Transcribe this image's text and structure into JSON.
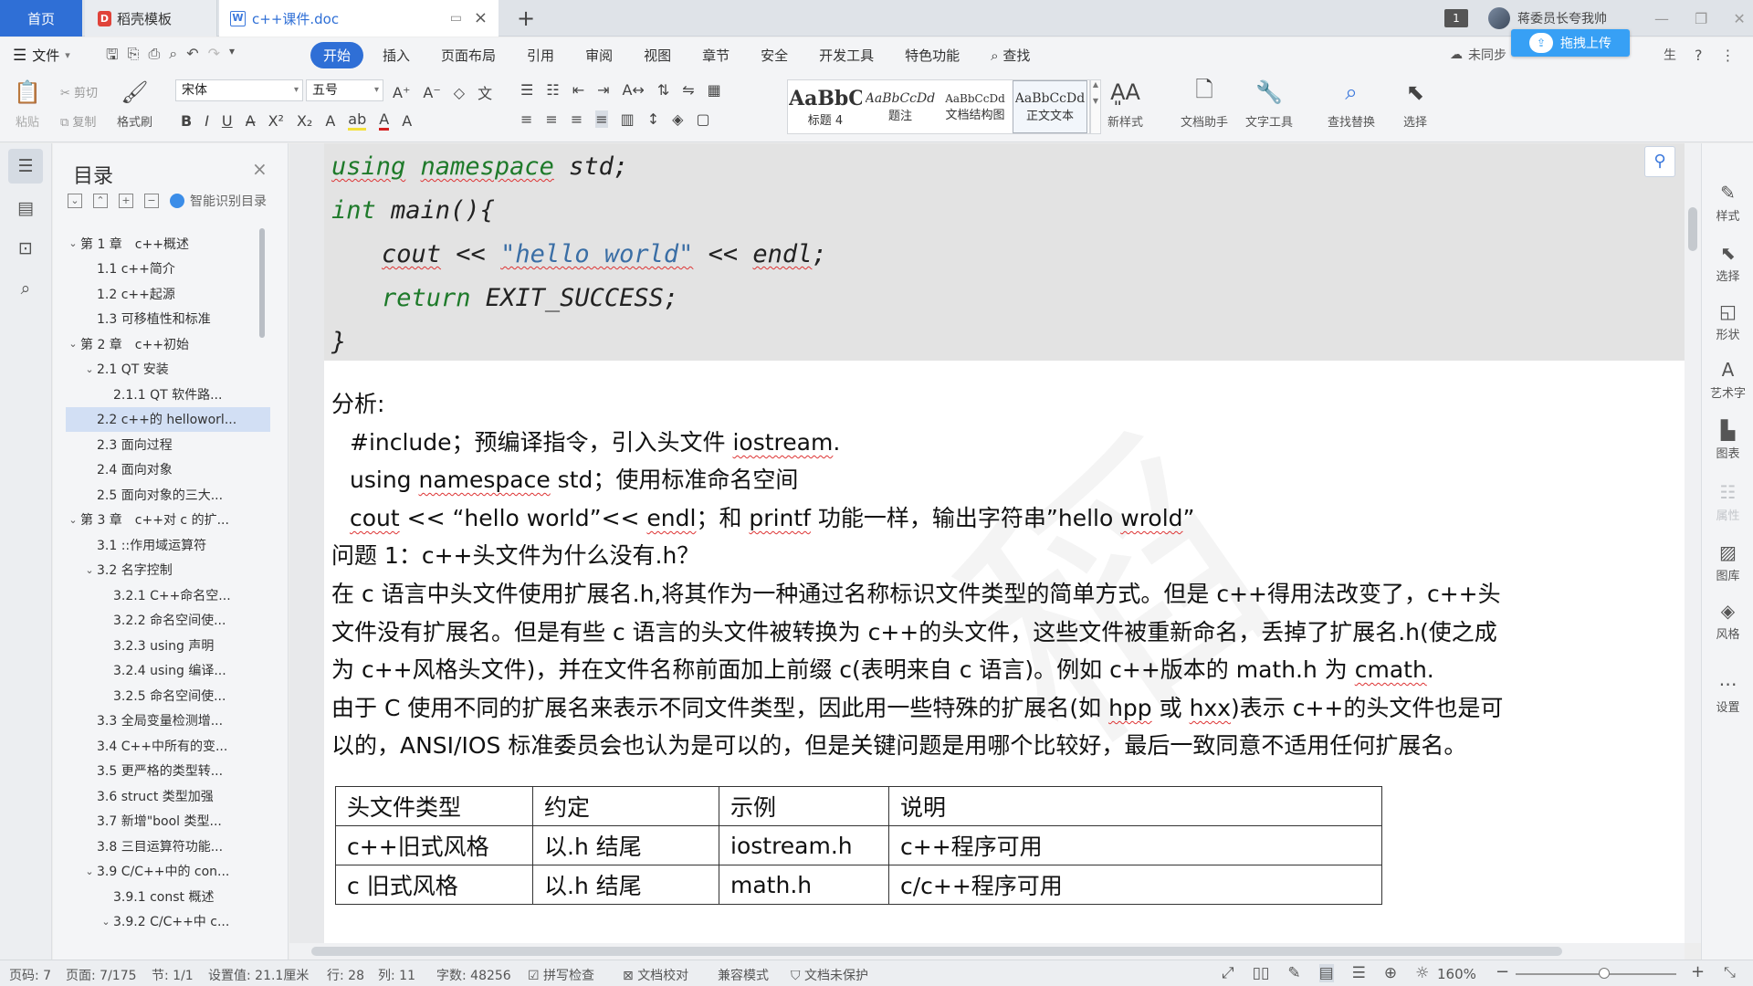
{
  "tabs": {
    "home": "首页",
    "daoke": "稻壳模板",
    "doc": "c++课件.doc",
    "badge": "1",
    "user": "蒋委员长夸我帅"
  },
  "menu": {
    "file": "文件",
    "items": [
      "开始",
      "插入",
      "页面布局",
      "引用",
      "审阅",
      "视图",
      "章节",
      "安全",
      "开发工具",
      "特色功能",
      "查找"
    ],
    "sync": "未同步",
    "upload": "拖拽上传",
    "share": "生"
  },
  "ribbon": {
    "paste": "粘贴",
    "cut": "剪切",
    "copy": "复制",
    "format_painter": "格式刷",
    "font_name": "宋体",
    "font_size": "五号",
    "styles": [
      {
        "sample": "AaBbCc",
        "name": "标题 4"
      },
      {
        "sample": "AaBbCcDd",
        "name": "题注"
      },
      {
        "sample": "AaBbCcDd",
        "name": "文档结构图"
      },
      {
        "sample": "AaBbCcDd",
        "name": "正文文本"
      }
    ],
    "new_style": "新样式",
    "doc_helper": "文档助手",
    "text_tools": "文字工具",
    "find_replace": "查找替换",
    "select": "选择"
  },
  "toc": {
    "title": "目录",
    "smart": "智能识别目录",
    "items": [
      {
        "label": "第 1 章　c++概述",
        "level": 1,
        "arrow": "v"
      },
      {
        "label": "1.1 c++简介",
        "level": 2,
        "arrow": ""
      },
      {
        "label": "1.2 c++起源",
        "level": 2,
        "arrow": ""
      },
      {
        "label": "1.3 可移植性和标准",
        "level": 2,
        "arrow": ""
      },
      {
        "label": "第 2 章　c++初始",
        "level": 1,
        "arrow": "v"
      },
      {
        "label": "2.1 QT 安装",
        "level": 2,
        "arrow": "v"
      },
      {
        "label": "2.1.1 QT 软件路...",
        "level": 3,
        "arrow": ""
      },
      {
        "label": "2.2 c++的 helloworl...",
        "level": 2,
        "arrow": "",
        "selected": true
      },
      {
        "label": "2.3 面向过程",
        "level": 2,
        "arrow": ""
      },
      {
        "label": "2.4 面向对象",
        "level": 2,
        "arrow": ""
      },
      {
        "label": "2.5 面向对象的三大...",
        "level": 2,
        "arrow": ""
      },
      {
        "label": "第 3 章　c++对 c 的扩...",
        "level": 1,
        "arrow": "v"
      },
      {
        "label": "3.1 ::作用域运算符",
        "level": 2,
        "arrow": ""
      },
      {
        "label": "3.2 名字控制",
        "level": 2,
        "arrow": "v"
      },
      {
        "label": "3.2.1 C++命名空...",
        "level": 3,
        "arrow": ""
      },
      {
        "label": "3.2.2 命名空间使...",
        "level": 3,
        "arrow": ""
      },
      {
        "label": "3.2.3 using 声明",
        "level": 3,
        "arrow": ""
      },
      {
        "label": "3.2.4 using 编译...",
        "level": 3,
        "arrow": ""
      },
      {
        "label": "3.2.5 命名空间使...",
        "level": 3,
        "arrow": ""
      },
      {
        "label": "3.3 全局变量检测增...",
        "level": 2,
        "arrow": ""
      },
      {
        "label": "3.4 C++中所有的变...",
        "level": 2,
        "arrow": ""
      },
      {
        "label": "3.5 更严格的类型转...",
        "level": 2,
        "arrow": ""
      },
      {
        "label": "3.6 struct 类型加强",
        "level": 2,
        "arrow": ""
      },
      {
        "label": "3.7 新增\"bool 类型...",
        "level": 2,
        "arrow": ""
      },
      {
        "label": "3.8 三目运算符功能...",
        "level": 2,
        "arrow": ""
      },
      {
        "label": "3.9 C/C++中的 con...",
        "level": 2,
        "arrow": "v"
      },
      {
        "label": "3.9.1 const 概述",
        "level": 3,
        "arrow": ""
      },
      {
        "label": "3.9.2 C/C++中 c...",
        "level": 3,
        "arrow": "v"
      }
    ]
  },
  "doc": {
    "code": {
      "line1_kw1": "using",
      "line1_kw2": "namespace",
      "line1_rest": " std;",
      "line2_kw": "int",
      "line2_rest": " main(){",
      "line3_a": "cout",
      "line3_b": " << ",
      "line3_str": "\"hello world\"",
      "line3_c": " << ",
      "line3_d": "endl",
      "line3_e": ";",
      "line4_kw": "return",
      "line4_rest": " EXIT_SUCCESS;",
      "line5": "}"
    },
    "analysis_heading": "分析:",
    "a1_pre": "#include；预编译指令，引入头文件 ",
    "a1_ul": "iostream",
    "a1_post": ".",
    "a2_pre": "using ",
    "a2_ul": "namespace",
    "a2_post": " std；使用标准命名空间",
    "a3_ul1": "cout",
    "a3_mid1": " << “hello world”<< ",
    "a3_ul2": "endl",
    "a3_mid2": "；和 ",
    "a3_ul3": "printf",
    "a3_mid3": " 功能一样，输出字符串”hello ",
    "a3_ul4": "wrold",
    "a3_post": "”",
    "question": "问题 1：c++头文件为什么没有.h？",
    "p1": "在 c 语言中头文件使用扩展名.h,将其作为一种通过名称标识文件类型的简单方式。但是 c++得用法改变了，c++头",
    "p2": "文件没有扩展名。但是有些 c 语言的头文件被转换为 c++的头文件，这些文件被重新命名，丢掉了扩展名.h(使之成",
    "p3_pre": "为 c++风格头文件)，并在文件名称前面加上前缀 c(表明来自 c 语言)。例如 c++版本的 math.h 为 ",
    "p3_ul": "cmath",
    "p3_post": ".",
    "p4_pre": "由于 C 使用不同的扩展名来表示不同文件类型，因此用一些特殊的扩展名(如 ",
    "p4_ul1": "hpp",
    "p4_mid": " 或 ",
    "p4_ul2": "hxx",
    "p4_post": ")表示 c++的头文件也是可",
    "p5": "以的，ANSI/IOS 标准委员会也认为是可以的，但是关键问题是用哪个比较好，最后一致同意不适用任何扩展名。",
    "table": {
      "headers": [
        "头文件类型",
        "约定",
        "示例",
        "说明"
      ],
      "rows": [
        [
          "c++旧式风格",
          "以.h 结尾",
          "iostream.h",
          "c++程序可用"
        ],
        [
          "c 旧式风格",
          "以.h 结尾",
          "math.h",
          "c/c++程序可用"
        ]
      ]
    }
  },
  "rightbar": [
    "样式",
    "选择",
    "形状",
    "艺术字",
    "图表",
    "属性",
    "图库",
    "风格",
    "设置"
  ],
  "status": {
    "page_no": "页码: 7",
    "pages": "页面: 7/175",
    "section": "节: 1/1",
    "setting": "设置值: 21.1厘米",
    "row": "行: 28",
    "col": "列: 11",
    "words": "字数: 48256",
    "spell": "拼写检查",
    "proof": "文档校对",
    "compat": "兼容模式",
    "protect": "文档未保护",
    "zoom": "160%",
    "zoom_level": 0.55
  }
}
